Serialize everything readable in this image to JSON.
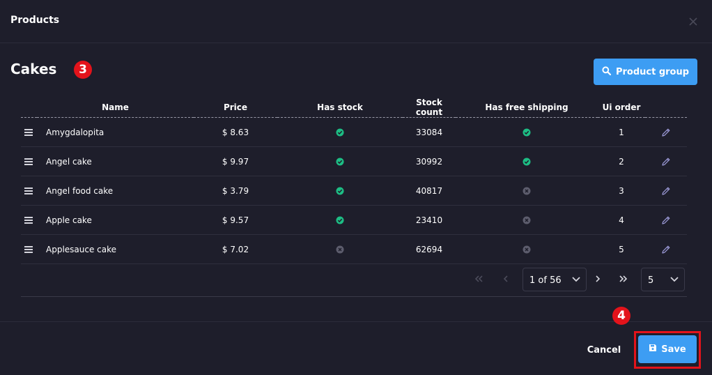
{
  "dialog": {
    "title": "Products"
  },
  "section": {
    "title": "Cakes",
    "step_badge": "3"
  },
  "toolbar": {
    "product_group_label": "Product group"
  },
  "table": {
    "columns": [
      "Name",
      "Price",
      "Has stock",
      "Stock count",
      "Has free shipping",
      "Ui order"
    ],
    "rows": [
      {
        "name": "Amygdalopita",
        "price": "$ 8.63",
        "has_stock": true,
        "stock_count": "33084",
        "free_shipping": true,
        "ui_order": "1"
      },
      {
        "name": "Angel cake",
        "price": "$ 9.97",
        "has_stock": true,
        "stock_count": "30992",
        "free_shipping": true,
        "ui_order": "2"
      },
      {
        "name": "Angel food cake",
        "price": "$ 3.79",
        "has_stock": true,
        "stock_count": "40817",
        "free_shipping": false,
        "ui_order": "3"
      },
      {
        "name": "Apple cake",
        "price": "$ 9.57",
        "has_stock": true,
        "stock_count": "23410",
        "free_shipping": false,
        "ui_order": "4"
      },
      {
        "name": "Applesauce cake",
        "price": "$ 7.02",
        "has_stock": false,
        "stock_count": "62694",
        "free_shipping": false,
        "ui_order": "5"
      }
    ]
  },
  "pagination": {
    "page_label": "1 of 56",
    "page_size": "5"
  },
  "footer": {
    "cancel_label": "Cancel",
    "save_label": "Save",
    "step_badge": "4"
  },
  "colors": {
    "accent": "#3d9df3",
    "check": "#1dbd84",
    "cross": "#5d5d6d",
    "highlight": "#e3131b",
    "background": "#1e1e2b"
  },
  "icons": {
    "close": "close-icon",
    "search": "search-icon",
    "drag": "drag-handle-icon",
    "check": "check-circle-icon",
    "cross": "cross-circle-icon",
    "edit": "pencil-icon",
    "first": "double-chevron-left-icon",
    "prev": "chevron-left-icon",
    "next": "chevron-right-icon",
    "last": "double-chevron-right-icon",
    "dropdown": "chevron-down-icon",
    "save": "floppy-disk-icon"
  }
}
